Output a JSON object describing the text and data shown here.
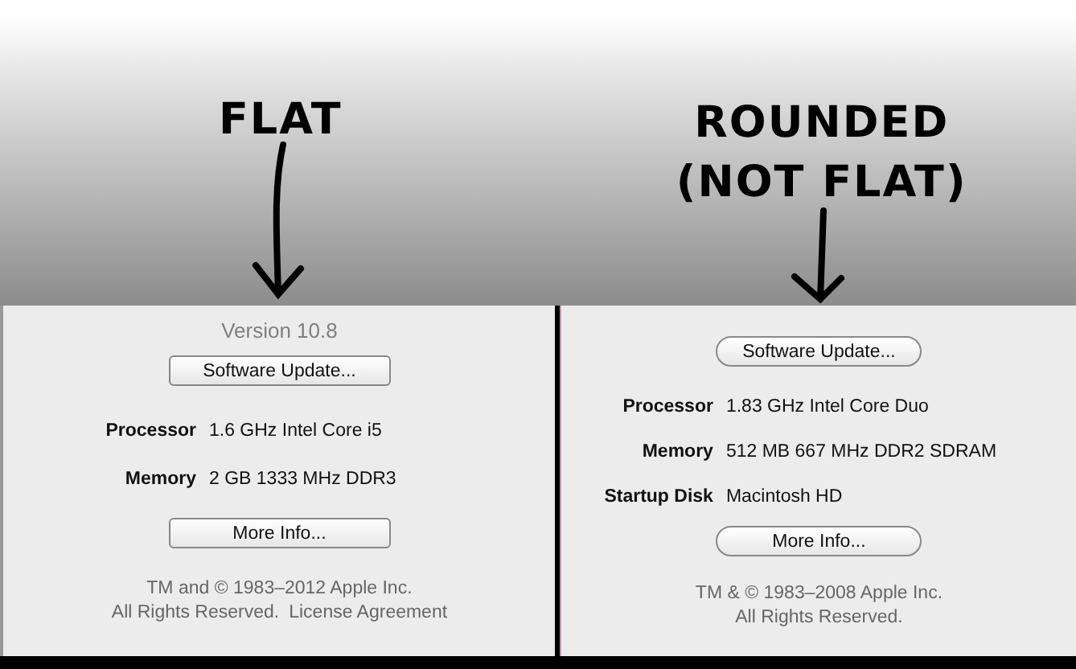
{
  "annotations": [
    {
      "lines": [
        "FLAT"
      ]
    },
    {
      "lines": [
        "ROUNDED",
        "(NOT FLAT)"
      ]
    }
  ],
  "panels": [
    {
      "kind": "flat",
      "version": "Version 10.8",
      "update_button": "Software Update...",
      "specs": [
        {
          "label": "Processor",
          "value": "1.6 GHz Intel Core i5"
        },
        {
          "label": "Memory",
          "value": "2 GB 1333 MHz DDR3"
        }
      ],
      "more_button": "More Info...",
      "footer": [
        "TM and © 1983–2012 Apple Inc.",
        "All Rights Reserved."
      ],
      "footer_link": "License Agreement"
    },
    {
      "kind": "rounded",
      "update_button": "Software Update...",
      "specs": [
        {
          "label": "Processor",
          "value": "1.83 GHz Intel Core Duo"
        },
        {
          "label": "Memory",
          "value": "512 MB 667 MHz DDR2 SDRAM"
        },
        {
          "label": "Startup Disk",
          "value": "Macintosh HD"
        }
      ],
      "more_button": "More Info...",
      "footer": [
        "TM & © 1983–2008 Apple Inc.",
        "All Rights Reserved."
      ]
    }
  ]
}
